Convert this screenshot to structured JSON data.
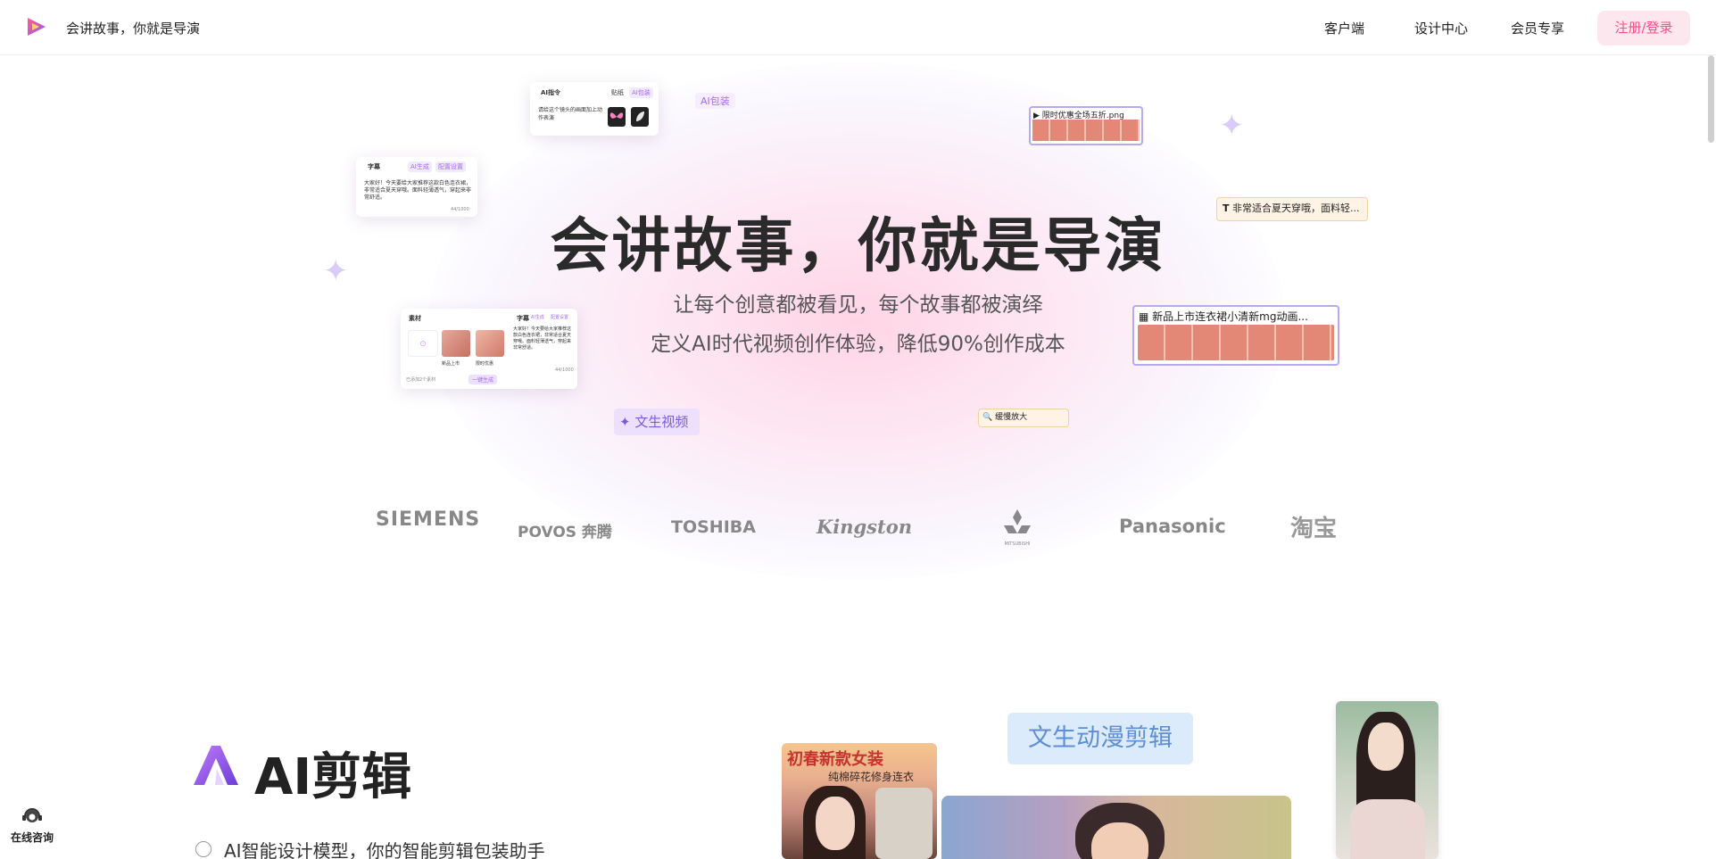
{
  "nav": {
    "brand": "会讲故事，你就是导演",
    "links": [
      "客户端",
      "设计中心",
      "会员专享"
    ],
    "login_label": "注册/登录"
  },
  "hero": {
    "title": "会讲故事，你就是导演",
    "subtitle1": "让每个创意都被看见，每个故事都被演绎",
    "subtitle2": "定义AI时代视频创作体验，降低90%创作成本"
  },
  "floating": {
    "ai_cmd_card": {
      "title": "AI指令",
      "tab1": "贴纸",
      "tab2": "AI包装",
      "text": "请给这个镜头的画面加上动作表演"
    },
    "subtitle_card": {
      "title": "字幕",
      "tab1": "AI生成",
      "tab2": "配置设置",
      "text": "大家好！今天要给大家推荐这款白色连衣裙，非常适合夏天穿哦。面料轻薄透气，穿起来非常舒适。",
      "count": "44/1000"
    },
    "material_card": {
      "title": "素材",
      "subtitle_label": "字幕",
      "tab1": "AI生成",
      "tab2": "配置设置",
      "thumb1": "新品上市",
      "thumb2": "限时优惠",
      "text": "大家好！今天要给大家推荐这款白色连衣裙，非常适合夏天穿哦。面料轻薄透气，穿起来非常舒适。",
      "count": "44/1000",
      "footer": "已添加2个素材",
      "action": "一键生成"
    },
    "ai_pack_tag": "AI包装",
    "promo_png_tag": "限时优惠全场五折.png",
    "comfort_tag": "非常适合夏天穿哦，面料轻...",
    "newdress_tag": "新品上市连衣裙小清新mg动画...",
    "text2video_tag": "文生视频",
    "slow_zoom_tag": "缓慢放大"
  },
  "brands": [
    "SIEMENS",
    "POVOS 奔腾",
    "TOSHIBA",
    "Kingston",
    "MITSUBISHI",
    "Panasonic",
    "淘宝"
  ],
  "section": {
    "title": "AI剪辑",
    "feature": "AI智能设计模型，你的智能剪辑包装助手",
    "anime_label": "文生动漫剪辑",
    "poster_title": "初春新款女装",
    "poster_sub": "纯棉碎花修身连衣"
  },
  "help": {
    "label": "在线咨询"
  },
  "colors": {
    "accent": "#ff4d85",
    "purple": "#8b5cf6",
    "lavender": "#e9defd"
  }
}
